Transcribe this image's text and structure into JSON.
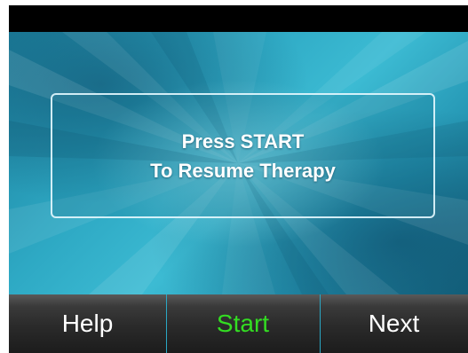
{
  "display": {
    "message_line_1": "Press START",
    "message_line_2": "To Resume Therapy"
  },
  "softkeys": {
    "left_label": "Help",
    "center_label": "Start",
    "right_label": "Next",
    "center_active_color": "#33dd22",
    "divider_color": "#2aa7c4"
  },
  "theme": {
    "background_accent": "#2ea9c4"
  }
}
